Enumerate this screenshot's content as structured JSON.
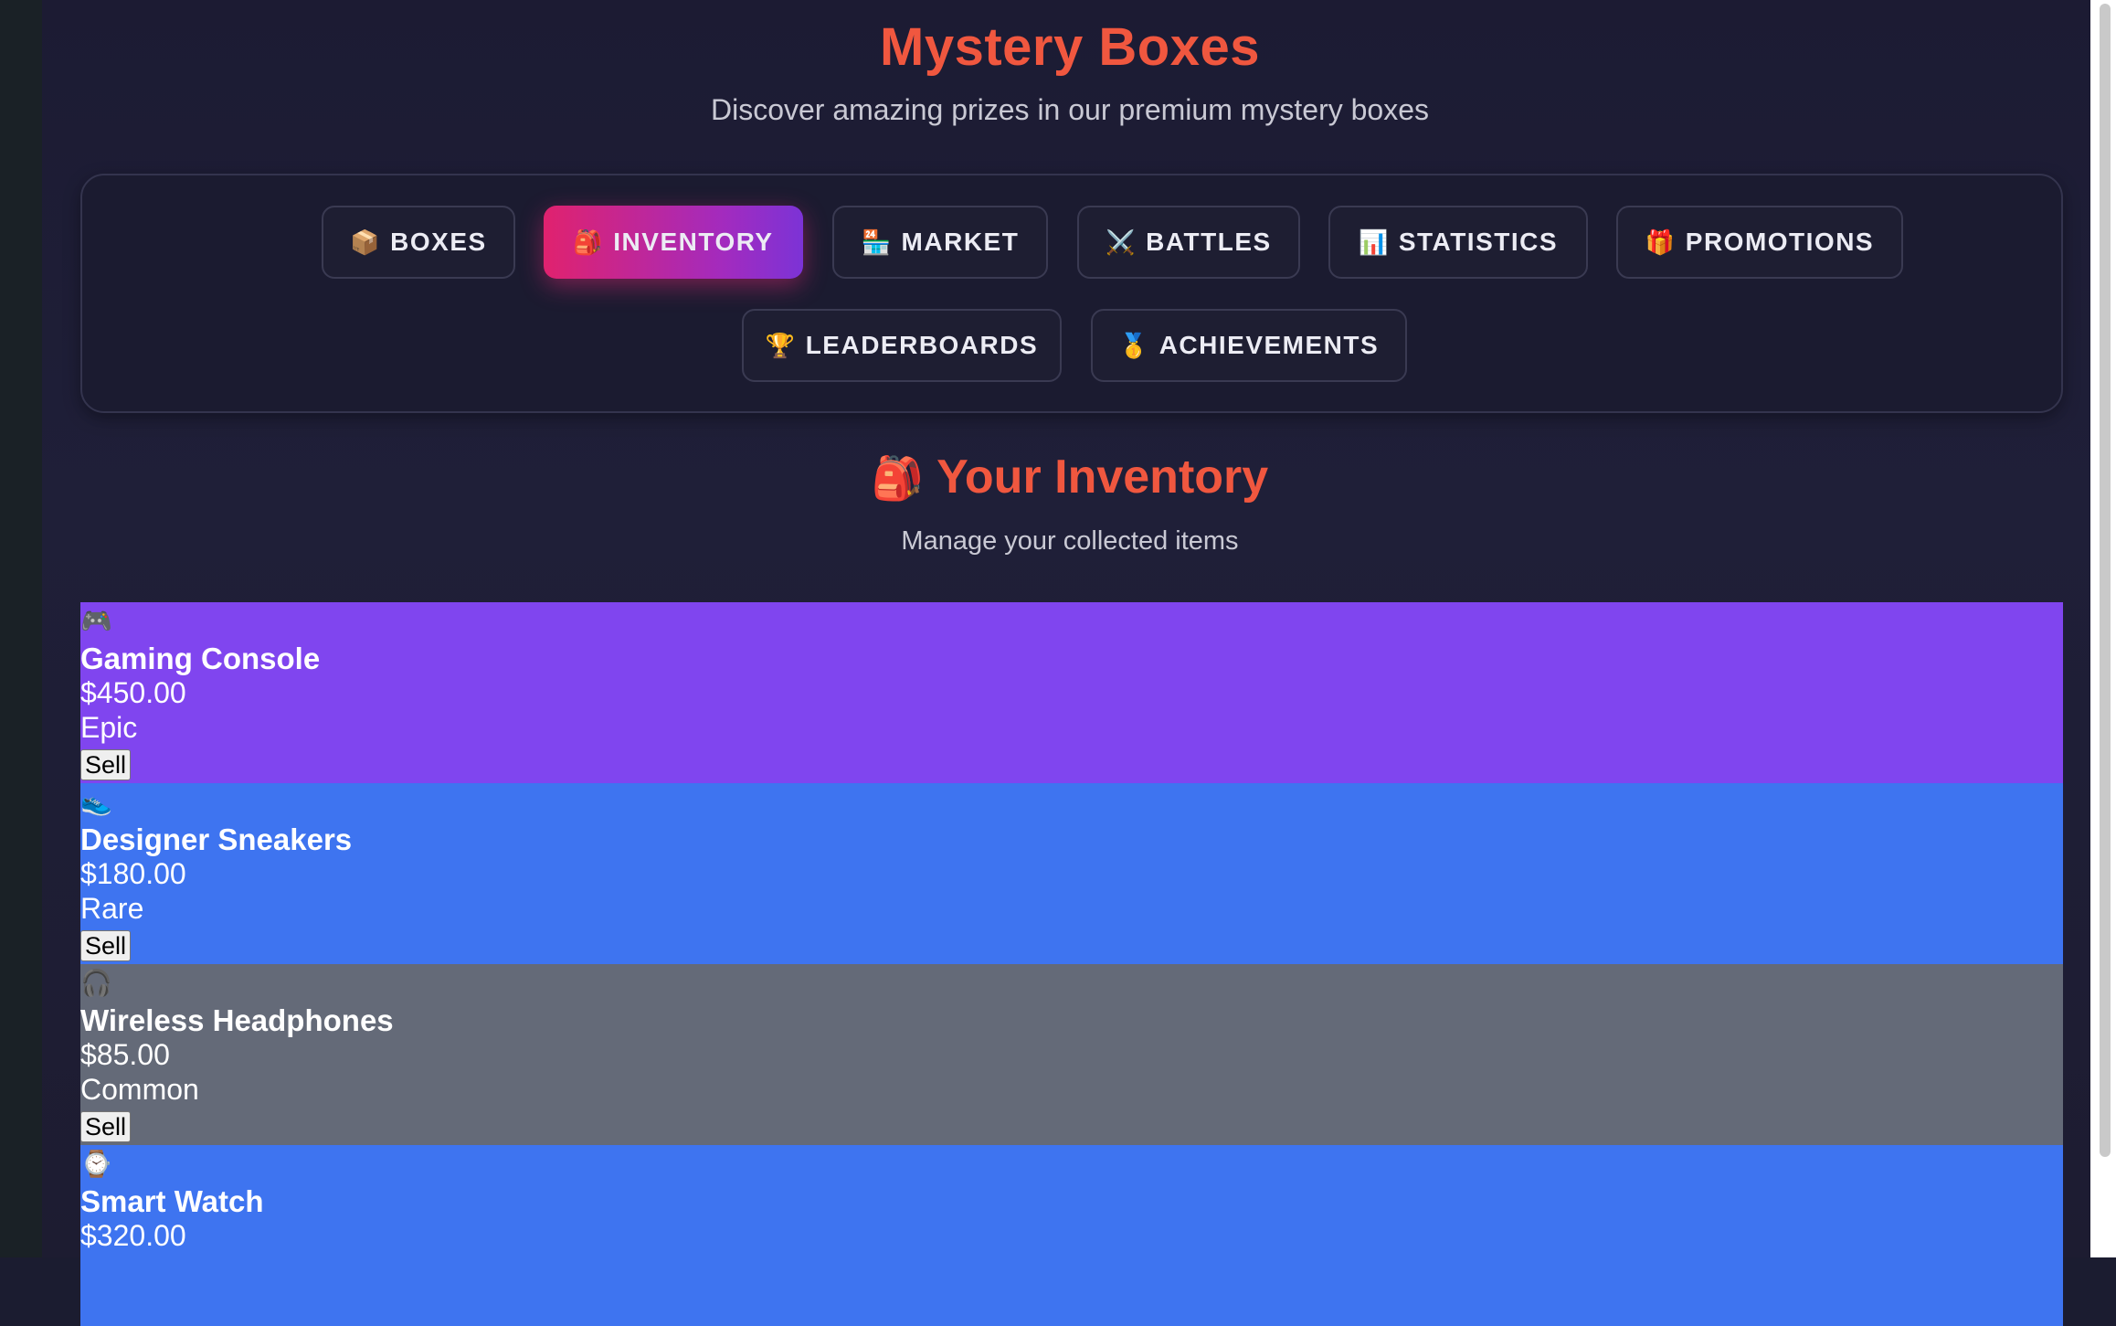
{
  "header": {
    "title": "Mystery Boxes",
    "subtitle": "Discover amazing prizes in our premium mystery boxes"
  },
  "nav": {
    "items": [
      {
        "icon": "📦",
        "label": "BOXES",
        "active": false
      },
      {
        "icon": "🎒",
        "label": "INVENTORY",
        "active": true
      },
      {
        "icon": "🏪",
        "label": "MARKET",
        "active": false
      },
      {
        "icon": "⚔️",
        "label": "BATTLES",
        "active": false
      },
      {
        "icon": "📊",
        "label": "STATISTICS",
        "active": false
      },
      {
        "icon": "🎁",
        "label": "PROMOTIONS",
        "active": false
      },
      {
        "icon": "🏆",
        "label": "LEADERBOARDS",
        "active": false
      },
      {
        "icon": "🥇",
        "label": "ACHIEVEMENTS",
        "active": false
      }
    ]
  },
  "inventory": {
    "icon": "🎒",
    "title": "Your Inventory",
    "subtitle": "Manage your collected items",
    "sell_label": "Sell",
    "items": [
      {
        "icon": "🎮",
        "name": "Gaming Console",
        "price": "$450.00",
        "rarity": "Epic",
        "color": "#8045ef"
      },
      {
        "icon": "👟",
        "name": "Designer Sneakers",
        "price": "$180.00",
        "rarity": "Rare",
        "color": "#3e74f0"
      },
      {
        "icon": "🎧",
        "name": "Wireless Headphones",
        "price": "$85.00",
        "rarity": "Common",
        "color": "#646a78"
      },
      {
        "icon": "⌚",
        "name": "Smart Watch",
        "price": "$320.00",
        "rarity": "",
        "color": "#3e74f0"
      }
    ]
  },
  "colors": {
    "accent": "#f0573f",
    "active_tab_start": "#e0226e",
    "active_tab_end": "#7c33d6",
    "background": "#1c1b33"
  }
}
